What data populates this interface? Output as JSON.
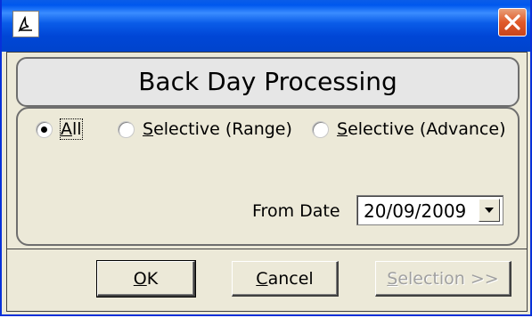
{
  "window": {
    "icon": "pdf-doc-icon",
    "close_icon": "close-icon",
    "close_color": "#e05a2a",
    "titlebar_color": "#0a5ce8"
  },
  "header": {
    "title": "Back Day Processing"
  },
  "options": {
    "radios": [
      {
        "label": "All",
        "selected": true
      },
      {
        "label": "Selective (Range)",
        "selected": false
      },
      {
        "label": "Selective (Advance)",
        "selected": false
      }
    ],
    "from_date_label": "From Date",
    "from_date_value": "20/09/2009",
    "dropdown_icon": "chevron-down-icon"
  },
  "buttons": {
    "ok_label": "OK",
    "cancel_label": "Cancel",
    "selection_label": "Selection >>"
  }
}
